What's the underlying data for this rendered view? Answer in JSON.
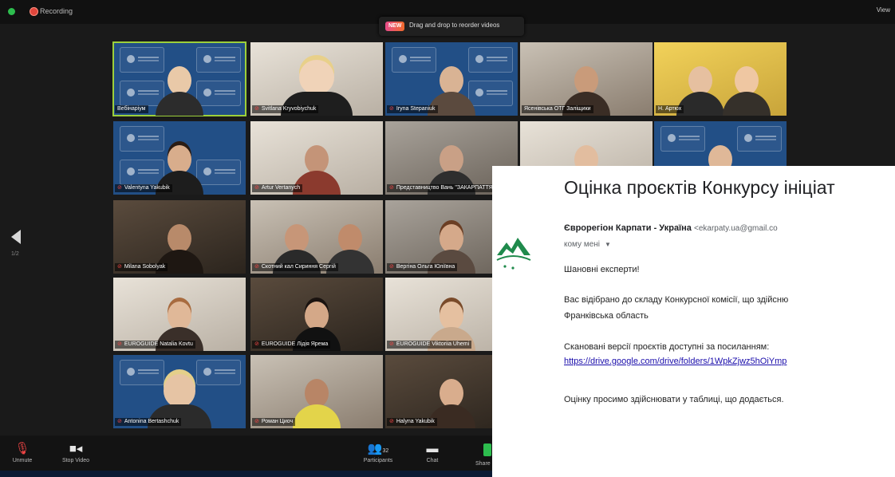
{
  "topbar": {
    "recording_label": "Recording",
    "drag_badge": "NEW",
    "drag_tip": "Drag and drop to reorder videos",
    "view_label": "View"
  },
  "pager": {
    "indicator": "1/2"
  },
  "participants": [
    {
      "name": "Вебінаріум",
      "muted": false
    },
    {
      "name": "Svitlana Kryvobiychuk",
      "muted": true
    },
    {
      "name": "Iryna Stepaniuk",
      "muted": true
    },
    {
      "name": "Ясенівська ОТГ Заліщики",
      "muted": false
    },
    {
      "name": "Н. Артюх",
      "muted": false
    },
    {
      "name": "Valentyna Yakubik",
      "muted": true
    },
    {
      "name": "Artur Vertanych",
      "muted": true
    },
    {
      "name": "Представництво Вань \"ЗАКАРПАТТЯ\"",
      "muted": true
    },
    {
      "name": "",
      "muted": false
    },
    {
      "name": "",
      "muted": false
    },
    {
      "name": "Milana Sobolyak",
      "muted": true
    },
    {
      "name": "Скотний кал Сириння Сергій",
      "muted": true
    },
    {
      "name": "Вергіна Ольга Юліївна",
      "muted": true
    },
    {
      "name": "EUROGUIDE Natalia Kovtu",
      "muted": true
    },
    {
      "name": "EUROGUIDE Лідія Ярема",
      "muted": true
    },
    {
      "name": "EUROGUIDE Viktoriia Uhemi",
      "muted": true
    },
    {
      "name": "Antonina Bertashchuk",
      "muted": true
    },
    {
      "name": "Роман Циоч",
      "muted": true
    },
    {
      "name": "Halyna Yakubik",
      "muted": true
    }
  ],
  "toolbar": {
    "unmute": "Unmute",
    "stop_video": "Stop Video",
    "participants": "Participants",
    "participants_count": "32",
    "chat": "Chat",
    "share": "Share S"
  },
  "email": {
    "subject": "Оцінка проєктів Конкурсу ініціат",
    "sender_name": "Єврорегіон Карпати - Україна",
    "sender_email": "<ekarpaty.ua@gmail.co",
    "recipient": "кому мені",
    "greeting": "Шановні експерти!",
    "body_line1": "Вас відібрано до складу Конкурсної комісії, що здійсню",
    "body_line2": "Франківська область",
    "body_line3": "Скановані версії проєктів доступні за посиланням:",
    "link": "https://drive.google.com/drive/folders/1WpkZjwz5hOiYmp",
    "body_line4": "Оцінку просимо здійснювати у таблиці, що додається.",
    "logo_color": "#1f8a4c"
  }
}
